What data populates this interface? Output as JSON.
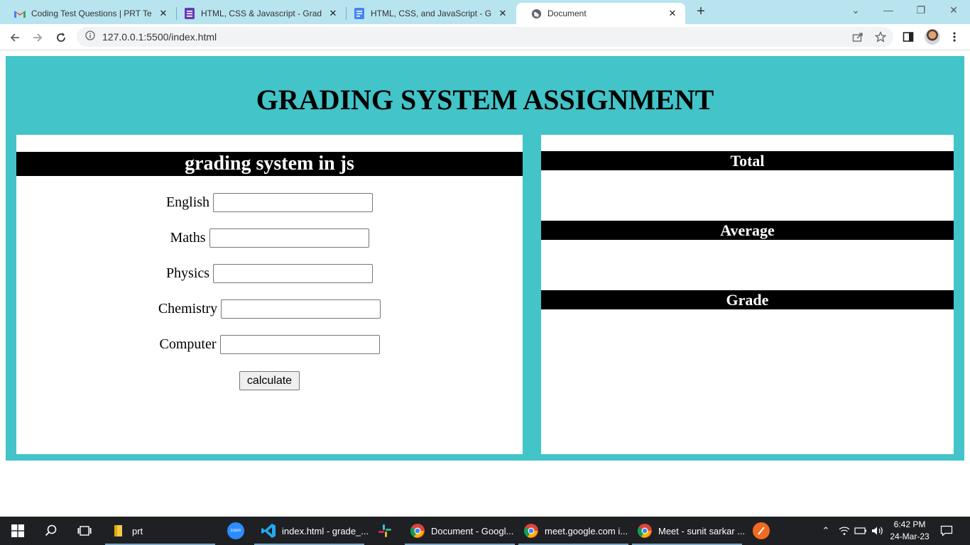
{
  "browser": {
    "tabs": [
      {
        "title": "Coding Test Questions | PRT Test",
        "icon": "gmail-icon"
      },
      {
        "title": "HTML, CSS & Javascript - Grade C",
        "icon": "forms-icon"
      },
      {
        "title": "HTML, CSS, and JavaScript - GRA",
        "icon": "docs-icon"
      },
      {
        "title": "Document",
        "icon": "globe-icon",
        "active": true
      }
    ],
    "url": "127.0.0.1:5500/index.html"
  },
  "page": {
    "heading": "GRADING SYSTEM ASSIGNMENT",
    "form": {
      "title": "grading system in js",
      "fields": [
        {
          "label": "English",
          "value": ""
        },
        {
          "label": "Maths",
          "value": ""
        },
        {
          "label": "Physics",
          "value": ""
        },
        {
          "label": "Chemistry",
          "value": ""
        },
        {
          "label": "Computer",
          "value": ""
        }
      ],
      "button_label": "calculate"
    },
    "results": {
      "total_label": "Total",
      "average_label": "Average",
      "grade_label": "Grade"
    },
    "colors": {
      "background": "#42c4c8",
      "header_bar": "#000000"
    }
  },
  "taskbar": {
    "items": [
      {
        "label": "prt",
        "icon": "folder-icon"
      },
      {
        "label": "",
        "icon": "zoom-icon"
      },
      {
        "label": "index.html - grade_...",
        "icon": "vscode-icon"
      },
      {
        "label": "",
        "icon": "slack-icon"
      },
      {
        "label": "Document - Googl...",
        "icon": "chrome-icon"
      },
      {
        "label": "meet.google.com i...",
        "icon": "chrome-icon"
      },
      {
        "label": "Meet - sunit sarkar ...",
        "icon": "chrome-icon"
      },
      {
        "label": "",
        "icon": "app-icon"
      }
    ],
    "time": "6:42 PM",
    "date": "24-Mar-23"
  }
}
